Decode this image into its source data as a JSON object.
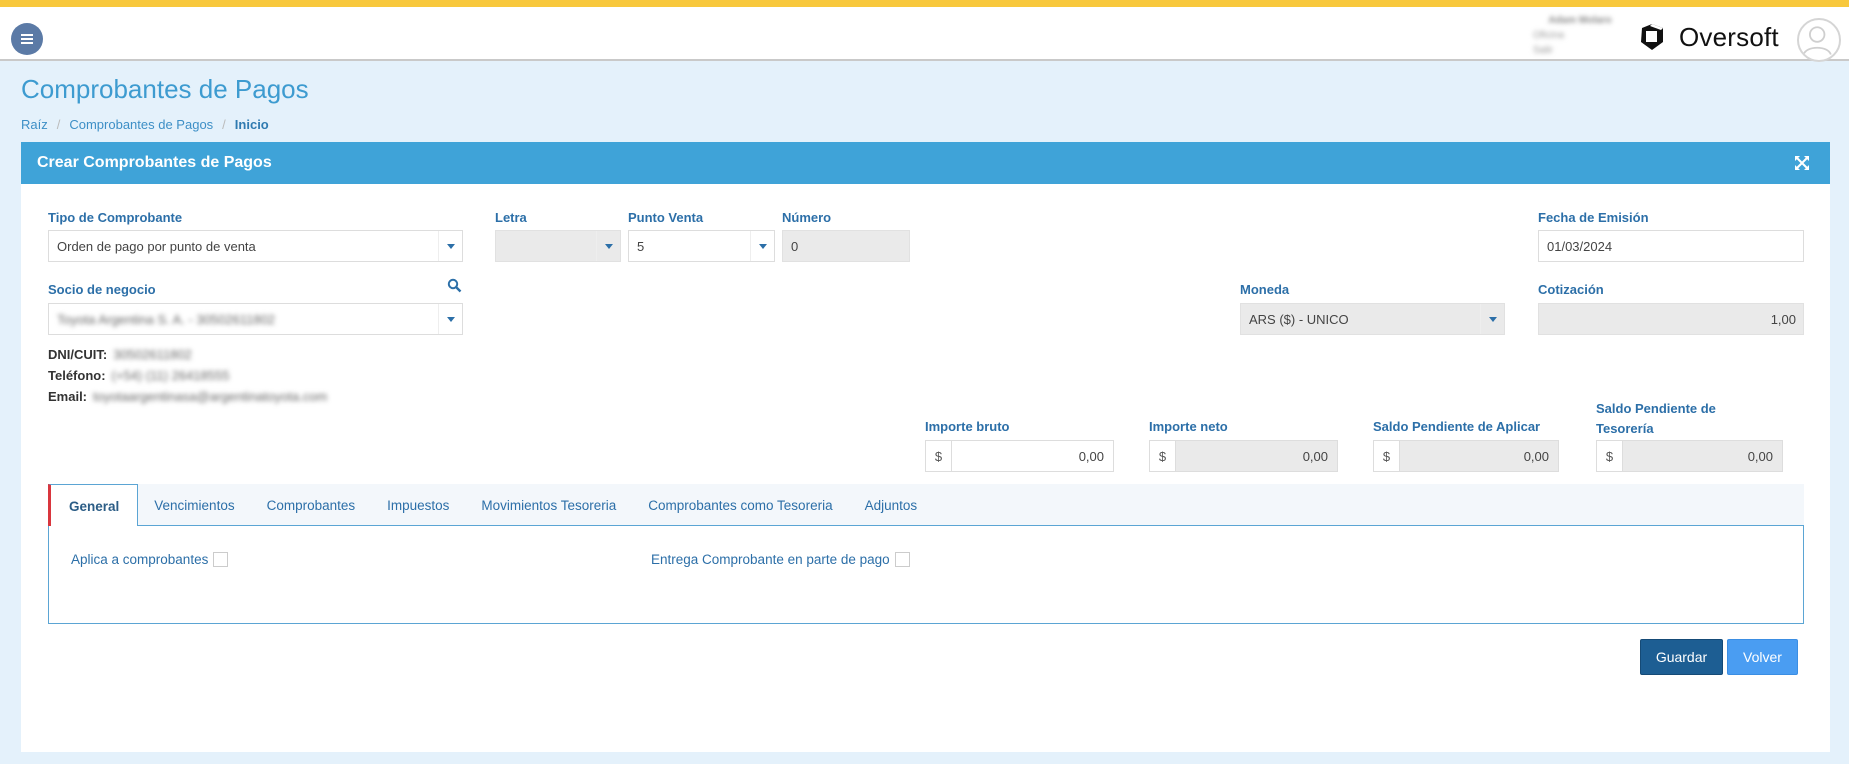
{
  "colors": {
    "top_stripe": "#f8c83c",
    "card_header": "#3fa3d8",
    "accent_text": "#2c6fa8",
    "active_tab_marker": "#d9363e",
    "save_button": "#1d5e93",
    "back_button": "#4a9df2"
  },
  "header": {
    "menu_icon": "hamburger-icon",
    "user_name": "Adam Molaro",
    "user_line1": "Oficina",
    "user_line2": "Salir",
    "brand_name": "Oversoft",
    "brand_icon": "oversoft-logo-icon",
    "avatar_icon": "user-avatar-icon"
  },
  "page": {
    "title": "Comprobantes de Pagos",
    "breadcrumb": [
      "Raíz",
      "Comprobantes de Pagos",
      "Inicio"
    ]
  },
  "card": {
    "title": "Crear Comprobantes de Pagos",
    "expand_icon": "expand-icon"
  },
  "form": {
    "tipo_comprobante": {
      "label": "Tipo de Comprobante",
      "value": "Orden de pago por punto de venta"
    },
    "letra": {
      "label": "Letra",
      "value": ""
    },
    "punto_venta": {
      "label": "Punto Venta",
      "value": "5"
    },
    "numero": {
      "label": "Número",
      "value": "0"
    },
    "fecha_emision": {
      "label": "Fecha de Emisión",
      "value": "01/03/2024"
    },
    "socio_negocio": {
      "label": "Socio de negocio",
      "value": "Toyota Argentina S. A. - 30502611802",
      "search_icon": "search-icon"
    },
    "moneda": {
      "label": "Moneda",
      "value": "ARS ($) - UNICO"
    },
    "cotizacion": {
      "label": "Cotización",
      "value": "1,00"
    },
    "socio_info": {
      "dni_label": "DNI/CUIT:",
      "dni_value": "30502611802",
      "telefono_label": "Teléfono:",
      "telefono_value": "(+54) (11) 26418555",
      "email_label": "Email:",
      "email_value": "toyotaargentinasa@argentinatoyota.com"
    },
    "amounts": {
      "currency_symbol": "$",
      "importe_bruto": {
        "label": "Importe bruto",
        "value": "0,00"
      },
      "importe_neto": {
        "label": "Importe neto",
        "value": "0,00"
      },
      "saldo_aplicar": {
        "label": "Saldo Pendiente de Aplicar",
        "value": "0,00"
      },
      "saldo_tesoreria": {
        "label_line1": "Saldo Pendiente de",
        "label_line2": "Tesorería",
        "value": "0,00"
      }
    }
  },
  "tabs": [
    "General",
    "Vencimientos",
    "Comprobantes",
    "Impuestos",
    "Movimientos Tesoreria",
    "Comprobantes como Tesoreria",
    "Adjuntos"
  ],
  "active_tab": "General",
  "general": {
    "aplica_label": "Aplica a comprobantes",
    "aplica_checked": false,
    "entrega_label": "Entrega Comprobante en parte de pago",
    "entrega_checked": false
  },
  "actions": {
    "save_label": "Guardar",
    "back_label": "Volver"
  }
}
